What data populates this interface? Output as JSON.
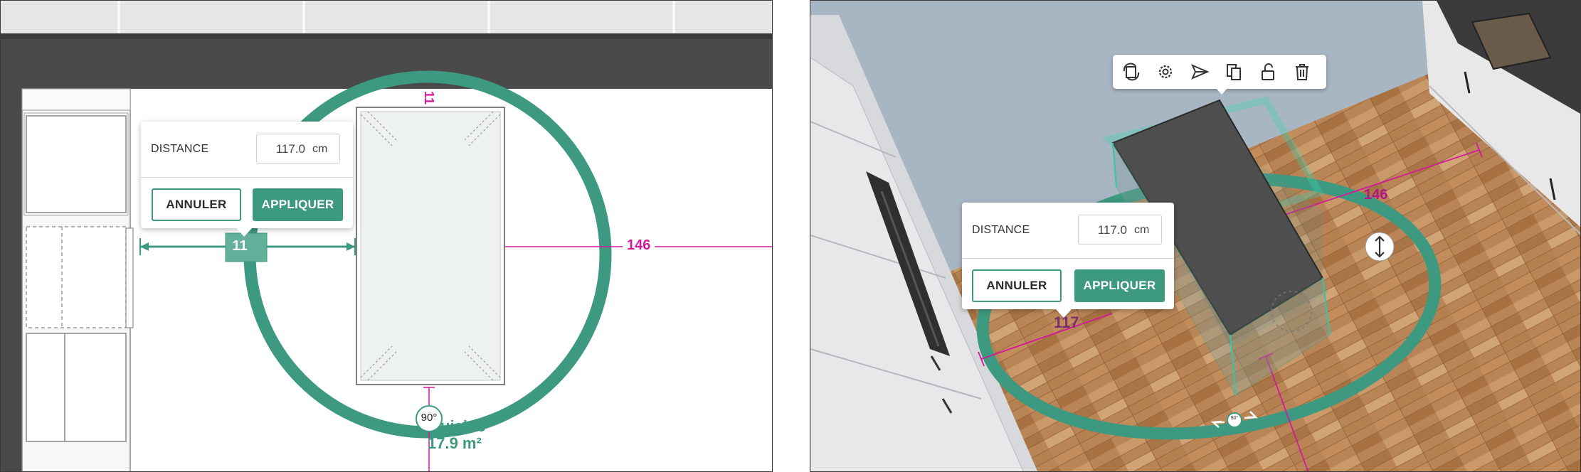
{
  "plan_view": {
    "distance_popup": {
      "label": "DISTANCE",
      "value": "117.0",
      "unit": "cm",
      "cancel_label": "ANNULER",
      "apply_label": "APPLIQUER"
    },
    "dimension_right": "146",
    "dimension_top": "11",
    "dimension_left": "11",
    "rotation_angle": "90°",
    "room_name": "uisine",
    "room_area": "17.9 m²"
  },
  "view_3d": {
    "toolbar": {
      "icons": [
        "replace-icon",
        "settings-icon",
        "send-icon",
        "duplicate-icon",
        "unlock-icon",
        "trash-icon"
      ]
    },
    "distance_popup": {
      "label": "DISTANCE",
      "value": "117.0",
      "unit": "cm",
      "cancel_label": "ANNULER",
      "apply_label": "APPLIQUER"
    },
    "dimension_right": "146",
    "dimension_left": "117",
    "rotation_angle": "90°"
  },
  "colors": {
    "accent": "#3d9a80",
    "dimension": "#d4189a",
    "wall": "#4a4a4a",
    "countertop": "#4e4e4e",
    "floor": "#b98557"
  }
}
